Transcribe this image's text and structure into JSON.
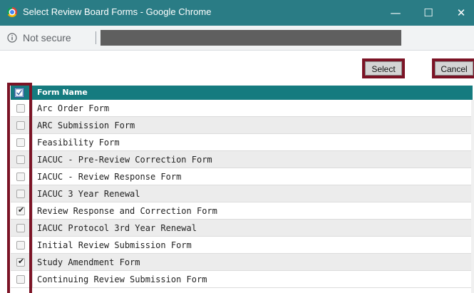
{
  "window": {
    "title": "Select Review Board Forms - Google Chrome",
    "controls": {
      "minimize": "—",
      "maximize": "☐",
      "close": "✕"
    }
  },
  "address_bar": {
    "security_label": "Not secure",
    "icon": "info-icon"
  },
  "toolbar": {
    "select_label": "Select",
    "cancel_label": "Cancel"
  },
  "grid": {
    "column_header": "Form Name",
    "header_icon": "check-all-icon",
    "rows": [
      {
        "label": "Arc Order Form",
        "checked": false
      },
      {
        "label": "ARC Submission Form",
        "checked": false
      },
      {
        "label": "Feasibility Form",
        "checked": false
      },
      {
        "label": "IACUC - Pre-Review Correction Form",
        "checked": false
      },
      {
        "label": "IACUC - Review Response Form",
        "checked": false
      },
      {
        "label": "IACUC 3 Year Renewal",
        "checked": false
      },
      {
        "label": "Review Response and Correction Form",
        "checked": true
      },
      {
        "label": "IACUC Protocol 3rd Year Renewal",
        "checked": false
      },
      {
        "label": "Initial Review Submission Form",
        "checked": false
      },
      {
        "label": "Study Amendment Form",
        "checked": true
      },
      {
        "label": "Continuing Review Submission Form",
        "checked": false
      }
    ]
  },
  "colors": {
    "title_bar": "#2a7c85",
    "grid_header": "#157b7f",
    "highlight_border": "#7b1325"
  }
}
